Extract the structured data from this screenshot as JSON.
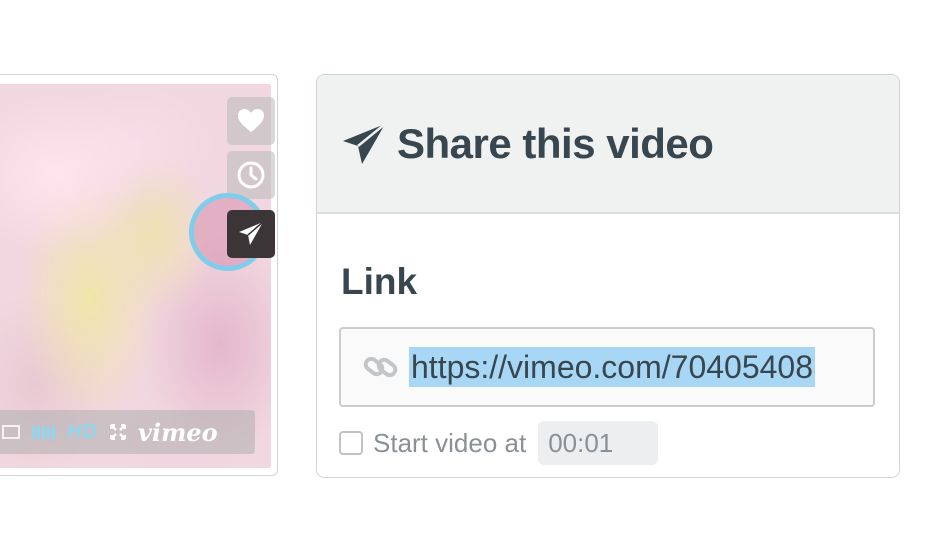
{
  "video": {
    "icons": {
      "like": "heart-icon",
      "watch_later": "clock-icon",
      "share": "paper-plane-icon",
      "fullscreen": "fullscreen-icon"
    },
    "controls": {
      "hd_label": "HD",
      "brand_label": "vimeo",
      "volume_level": 1.0
    },
    "accent_color": "#7fcdea"
  },
  "share_panel": {
    "icon": "paper-plane-icon",
    "title": "Share this video",
    "link_section_label": "Link",
    "link_icon": "chain-link-icon",
    "link_url": "https://vimeo.com/70405408",
    "start_checkbox_checked": false,
    "start_label": "Start video at",
    "start_time": "00:01"
  },
  "colors": {
    "heading_text": "#38464f",
    "muted_text": "#8a9196",
    "selection_highlight": "#a7d7f5",
    "header_background": "#f0f2f2"
  }
}
